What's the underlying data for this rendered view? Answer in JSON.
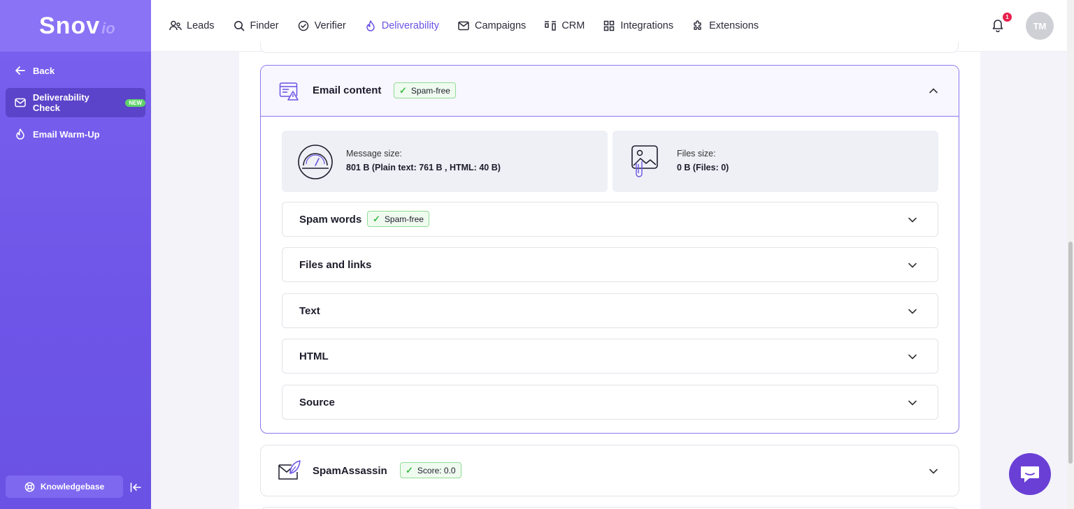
{
  "sidebar": {
    "logo_main": "Snov",
    "logo_sub": "io",
    "back_label": "Back",
    "items": [
      {
        "label": "Deliverability Check",
        "badge": "NEW"
      },
      {
        "label": "Email Warm-Up"
      }
    ],
    "knowledgebase_label": "Knowledgebase"
  },
  "nav": {
    "items": [
      {
        "label": "Leads",
        "icon": "users-icon"
      },
      {
        "label": "Finder",
        "icon": "search-icon"
      },
      {
        "label": "Verifier",
        "icon": "check-circle-icon"
      },
      {
        "label": "Deliverability",
        "icon": "flame-icon",
        "active": true
      },
      {
        "label": "Campaigns",
        "icon": "mail-icon"
      },
      {
        "label": "CRM",
        "icon": "kanban-icon"
      },
      {
        "label": "Integrations",
        "icon": "grid-icon"
      },
      {
        "label": "Extensions",
        "icon": "puzzle-icon"
      }
    ],
    "notification_count": "1",
    "avatar_initials": "TM"
  },
  "email_content": {
    "title": "Email content",
    "badge": "Spam-free",
    "message_size_label": "Message size:",
    "message_size_value": "801 B (Plain text: 761 B , HTML: 40 B)",
    "files_size_label": "Files size:",
    "files_size_value": "0 B (Files: 0)",
    "sections": [
      {
        "title": "Spam words",
        "badge": "Spam-free"
      },
      {
        "title": "Files and links"
      },
      {
        "title": "Text"
      },
      {
        "title": "HTML"
      },
      {
        "title": "Source"
      }
    ]
  },
  "spamassassin": {
    "title": "SpamAssassin",
    "badge": "Score: 0.0"
  },
  "colors": {
    "accent": "#7b61ee",
    "success": "#3cbb48",
    "notification": "#e8204e"
  }
}
